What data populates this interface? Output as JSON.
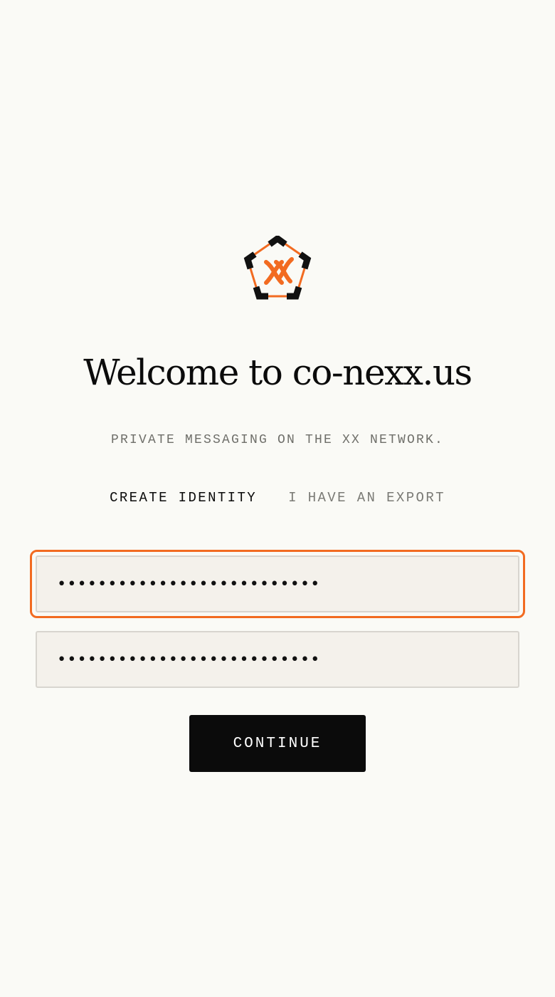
{
  "logo": {
    "icon": "pentagon-xx-logo-icon",
    "colors": {
      "frame": "#111111",
      "accent": "#F26B21"
    }
  },
  "header": {
    "title": "Welcome to co-nexx.us",
    "tagline": "PRIVATE MESSAGING ON THE XX NETWORK."
  },
  "tabs": [
    {
      "label": "CREATE IDENTITY",
      "active": true
    },
    {
      "label": "I HAVE AN EXPORT",
      "active": false
    }
  ],
  "form": {
    "password": {
      "value": "••••••••••••••••••••••••••",
      "focused": true
    },
    "password_confirm": {
      "value": "••••••••••••••••••••••••••",
      "focused": false
    },
    "continue_label": "CONTINUE"
  },
  "colors": {
    "background": "#FAFAF6",
    "focus_ring": "#F26B21",
    "field_background": "#F4F1EB",
    "button_background": "#0B0B0B"
  }
}
